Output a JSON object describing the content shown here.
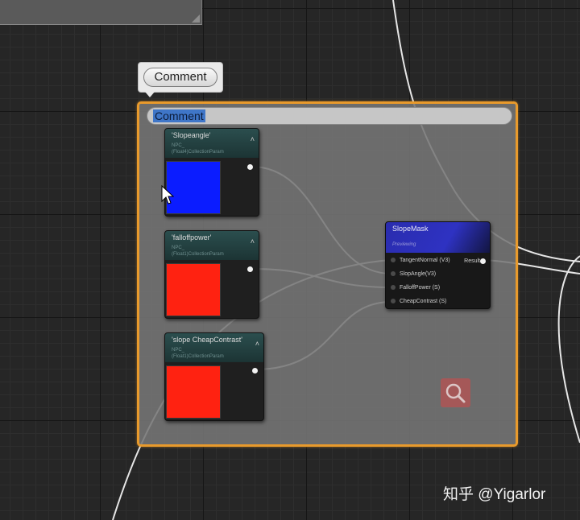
{
  "comment_bubble": {
    "label": "Comment"
  },
  "comment_box": {
    "title": "Comment"
  },
  "param_nodes": [
    {
      "title": "'Slopeangle'",
      "subtitle": "NPC_\n(Float4)CollectionParam",
      "color": "#0b1cff"
    },
    {
      "title": "'falloffpower'",
      "subtitle": "NPC_\n(Float1)CollectionParam",
      "color": "#ff2211"
    },
    {
      "title": "'slope CheapContrast'",
      "subtitle": "NPC_\n(Float1)CollectionParam",
      "color": "#ff2211"
    }
  ],
  "slopemask": {
    "title": "SlopeMask",
    "subtitle": "Previewing",
    "inputs": [
      "TangentNormal (V3)",
      "SlopAngle(V3)",
      "FalloffPower (S)",
      "CheapContrast (S)"
    ],
    "output": "Result"
  },
  "accent_color": "#e89a2c",
  "watermark": "知乎 @Yigarlor"
}
